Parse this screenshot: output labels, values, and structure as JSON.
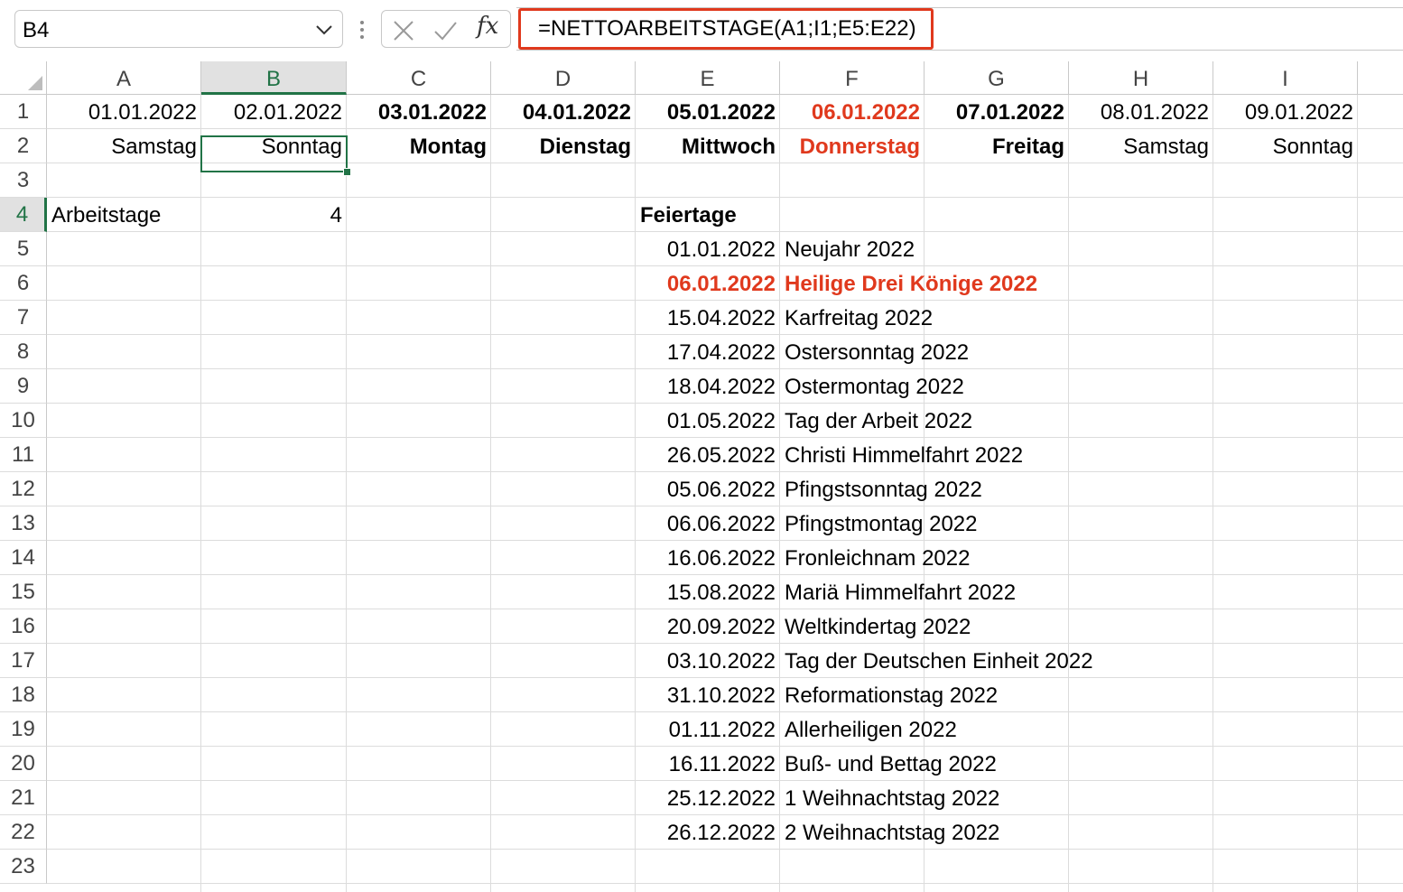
{
  "name_box": "B4",
  "formula": "=NETTOARBEITSTAGE(A1;I1;E5:E22)",
  "fx_label": "fx",
  "columns": [
    "A",
    "B",
    "C",
    "D",
    "E",
    "F",
    "G",
    "H",
    "I"
  ],
  "rows": [
    "1",
    "2",
    "3",
    "4",
    "5",
    "6",
    "7",
    "8",
    "9",
    "10",
    "11",
    "12",
    "13",
    "14",
    "15",
    "16",
    "17",
    "18",
    "19",
    "20",
    "21",
    "22",
    "23"
  ],
  "row1": [
    "01.01.2022",
    "02.01.2022",
    "03.01.2022",
    "04.01.2022",
    "05.01.2022",
    "06.01.2022",
    "07.01.2022",
    "08.01.2022",
    "09.01.2022"
  ],
  "row2": [
    "Samstag",
    "Sonntag",
    "Montag",
    "Dienstag",
    "Mittwoch",
    "Donnerstag",
    "Freitag",
    "Samstag",
    "Sonntag"
  ],
  "a4": "Arbeitstage",
  "b4": "4",
  "e4": "Feiertage",
  "holidays": [
    {
      "date": "01.01.2022",
      "name": "Neujahr 2022"
    },
    {
      "date": "06.01.2022",
      "name": "Heilige Drei Könige 2022"
    },
    {
      "date": "15.04.2022",
      "name": "Karfreitag 2022"
    },
    {
      "date": "17.04.2022",
      "name": "Ostersonntag 2022"
    },
    {
      "date": "18.04.2022",
      "name": "Ostermontag 2022"
    },
    {
      "date": "01.05.2022",
      "name": "Tag der Arbeit 2022"
    },
    {
      "date": "26.05.2022",
      "name": "Christi Himmelfahrt 2022"
    },
    {
      "date": "05.06.2022",
      "name": "Pfingstsonntag 2022"
    },
    {
      "date": "06.06.2022",
      "name": "Pfingstmontag 2022"
    },
    {
      "date": "16.06.2022",
      "name": "Fronleichnam 2022"
    },
    {
      "date": "15.08.2022",
      "name": "Mariä Himmelfahrt 2022"
    },
    {
      "date": "20.09.2022",
      "name": "Weltkindertag 2022"
    },
    {
      "date": "03.10.2022",
      "name": "Tag der Deutschen Einheit 2022"
    },
    {
      "date": "31.10.2022",
      "name": "Reformationstag 2022"
    },
    {
      "date": "01.11.2022",
      "name": "Allerheiligen 2022"
    },
    {
      "date": "16.11.2022",
      "name": "Buß- und Bettag 2022"
    },
    {
      "date": "25.12.2022",
      "name": "1 Weihnachtstag 2022"
    },
    {
      "date": "26.12.2022",
      "name": "2 Weihnachtstag 2022"
    }
  ],
  "colors": {
    "highlight_red": "#e0391d",
    "selection_green": "#217346"
  }
}
